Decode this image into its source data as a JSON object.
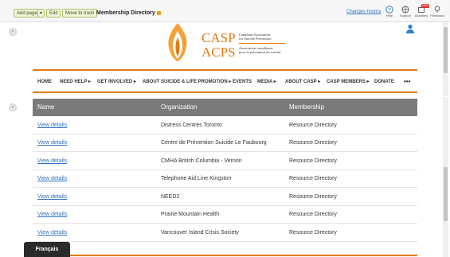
{
  "toolbar": {
    "add_page": "Add page",
    "add_page_dropdown": "▾",
    "edit": "Edit",
    "move_to_trash": "Move to trash",
    "page_title": "Membership Directory",
    "changes_history": "Changes history",
    "icons": [
      {
        "name": "help-icon",
        "label": "Help"
      },
      {
        "name": "support-icon",
        "label": "Support"
      },
      {
        "name": "academy-icon",
        "label": "Academy"
      },
      {
        "name": "feedback-icon",
        "label": "Feedback"
      }
    ],
    "academy_badge": "NEW"
  },
  "logo": {
    "casp": "CASP",
    "acps": "ACPS",
    "en_line1": "Canadian Association",
    "en_line2": "for Suicide Prevention",
    "fr_line1": "Association canadienne",
    "fr_line2": "pour la prévention du suicide"
  },
  "nav": [
    "HOME",
    "NEED HELP ▸",
    "GET INVOLVED ▸",
    "ABOUT SUICIDE & LIFE PROMOTION ▸",
    "EVENTS",
    "MEDIA ▸",
    "ABOUT CASP ▸",
    "CASP MEMBERS ▸",
    "DONATE",
    "•••"
  ],
  "table": {
    "headers": [
      "Name",
      "Organization",
      "Membership"
    ],
    "rows": [
      {
        "name": "View details",
        "organization": "Distress Centres Toronto",
        "membership": "Resource Directory"
      },
      {
        "name": "View details",
        "organization": "Centre de Prévention Suicide Le Faubourg",
        "membership": "Resource Directory"
      },
      {
        "name": "View details",
        "organization": "CMHA British Columbia - Vernon",
        "membership": "Resource Directory"
      },
      {
        "name": "View details",
        "organization": "Telephone Aid Line Kingston",
        "membership": "Resource Directory"
      },
      {
        "name": "View details",
        "organization": "NEED2",
        "membership": "Resource Directory"
      },
      {
        "name": "View details",
        "organization": "Prairie Mountain Health",
        "membership": "Resource Directory"
      },
      {
        "name": "View details",
        "organization": "Vancouver Island Crisis Society",
        "membership": "Resource Directory"
      }
    ]
  },
  "language_button": "Français",
  "colors": {
    "accent_orange": "#e07a10",
    "table_header": "#7a7a7a",
    "link_blue": "#2b6fbf",
    "user_icon_blue": "#2b7fd0"
  }
}
